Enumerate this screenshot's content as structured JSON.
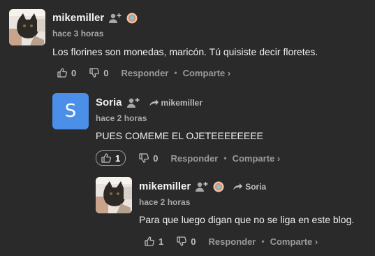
{
  "comments": [
    {
      "author": "mikemiller",
      "time": "hace 3 horas",
      "text": "Los florines son monedas, maricón. Tú quisiste decir floretes.",
      "upvotes": "0",
      "downvotes": "0",
      "reply_label": "Responder",
      "share_label": "Comparte ›"
    },
    {
      "author": "Soria",
      "avatar_letter": "S",
      "reply_to": "mikemiller",
      "time": "hace 2 horas",
      "text": "PUES COMEME EL OJETEEEEEEEE",
      "upvotes": "1",
      "downvotes": "0",
      "reply_label": "Responder",
      "share_label": "Comparte ›"
    },
    {
      "author": "mikemiller",
      "reply_to": "Soria",
      "time": "hace 2 horas",
      "text": "Para que luego digan que no se liga en este blog.",
      "upvotes": "1",
      "downvotes": "0",
      "reply_label": "Responder",
      "share_label": "Comparte ›"
    }
  ],
  "colors": {
    "background": "#2a2a2a",
    "avatar_blue": "#4b8fe8",
    "meta_text": "#9a9a9a"
  }
}
